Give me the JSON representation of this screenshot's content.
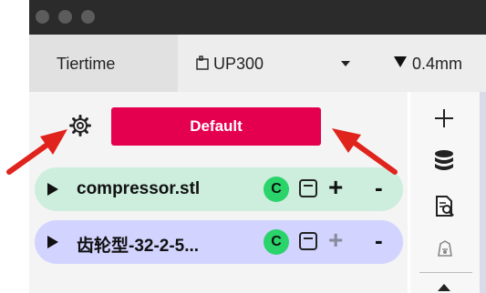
{
  "toolbar": {
    "brand": "Tiertime",
    "printer": "UP300",
    "nozzle": "0.4mm"
  },
  "profile_button": "Default",
  "models": [
    {
      "name": "compressor.stl",
      "badge": "C",
      "plus": "+",
      "minus": "-",
      "active": true
    },
    {
      "name": "齿轮型-32-2-5...",
      "badge": "C",
      "plus": "+",
      "minus": "-",
      "active": false
    }
  ],
  "colors": {
    "accent": "#e5004f",
    "row_green": "#cdeedd",
    "row_purple": "#d2d3ff",
    "badge": "#2ad46b",
    "annotation_arrow": "#e0231c"
  },
  "icons": [
    "settings-gear-icon",
    "add-icon",
    "database-icon",
    "file-inspect-icon",
    "shape-icon"
  ]
}
